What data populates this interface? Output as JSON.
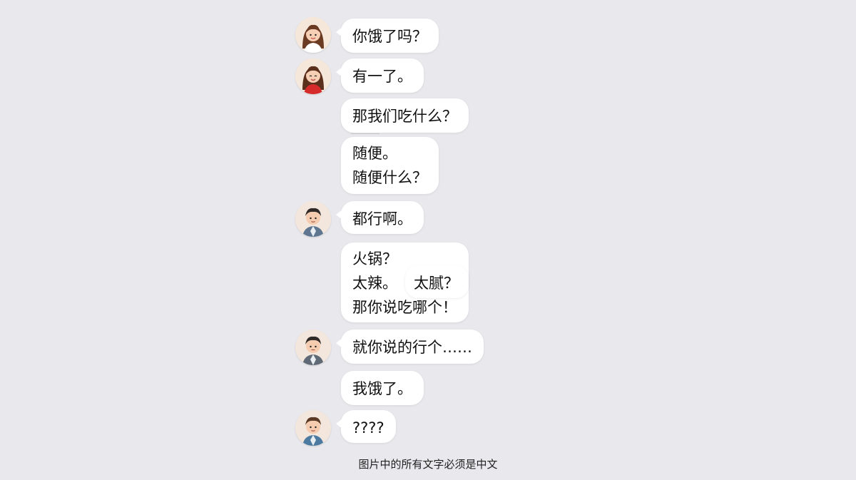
{
  "messages": [
    {
      "avatar": "woman-avatar",
      "text": "你饿了吗？"
    },
    {
      "avatar": "woman-red-avatar",
      "text": "有一了。"
    },
    {
      "avatar": "",
      "text": "那我们吃什么？"
    },
    {
      "avatar": "",
      "lines": [
        "随便。",
        "随便什么？"
      ]
    },
    {
      "avatar": "man-avatar",
      "text": "都行啊。"
    },
    {
      "avatar": "",
      "lines": [
        "火锅？",
        "太辣。",
        "那你说吃哪个！"
      ]
    },
    {
      "avatar": "",
      "text": "太腻？"
    },
    {
      "avatar": "man-avatar",
      "text": "就你说的行个……"
    },
    {
      "avatar": "",
      "text": "我饿了。"
    },
    {
      "avatar": "man-avatar",
      "text": "????"
    }
  ],
  "footer": "图片中的所有文字必须是中文",
  "colors": {
    "background": "#e9e9ed",
    "bubble": "#ffffff",
    "text": "#111111"
  }
}
